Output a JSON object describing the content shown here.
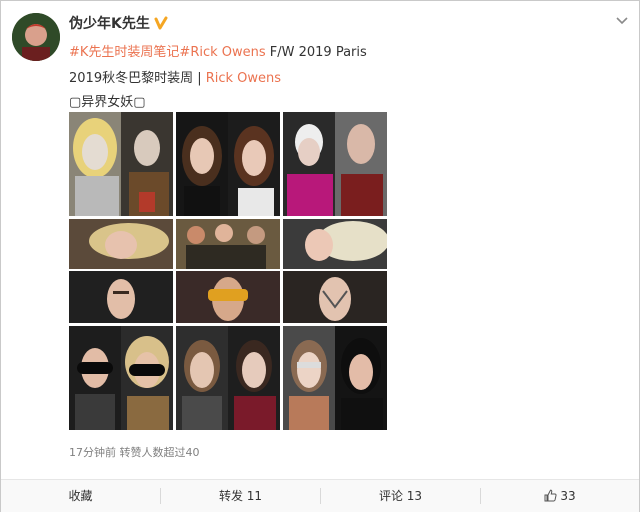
{
  "post": {
    "username": "伪少年K先生",
    "verified_icon": "verified-v-icon",
    "hashtag": "#K先生时装周笔记#",
    "brand_link": "Rick Owens",
    "season_text": " F/W 2019 Paris",
    "line2_prefix": "2019秋冬巴黎时装周 | ",
    "line2_link": "Rick Owens",
    "line3": "▢异界女妖▢",
    "meta": "17分钟前 转赞人数超过40"
  },
  "toolbar": {
    "collect_label": "收藏",
    "repost_label": "转发 11",
    "comment_label": "评论 13",
    "like_label": "33"
  },
  "colors": {
    "accent": "#eb7350",
    "text": "#333333",
    "muted": "#808080"
  }
}
